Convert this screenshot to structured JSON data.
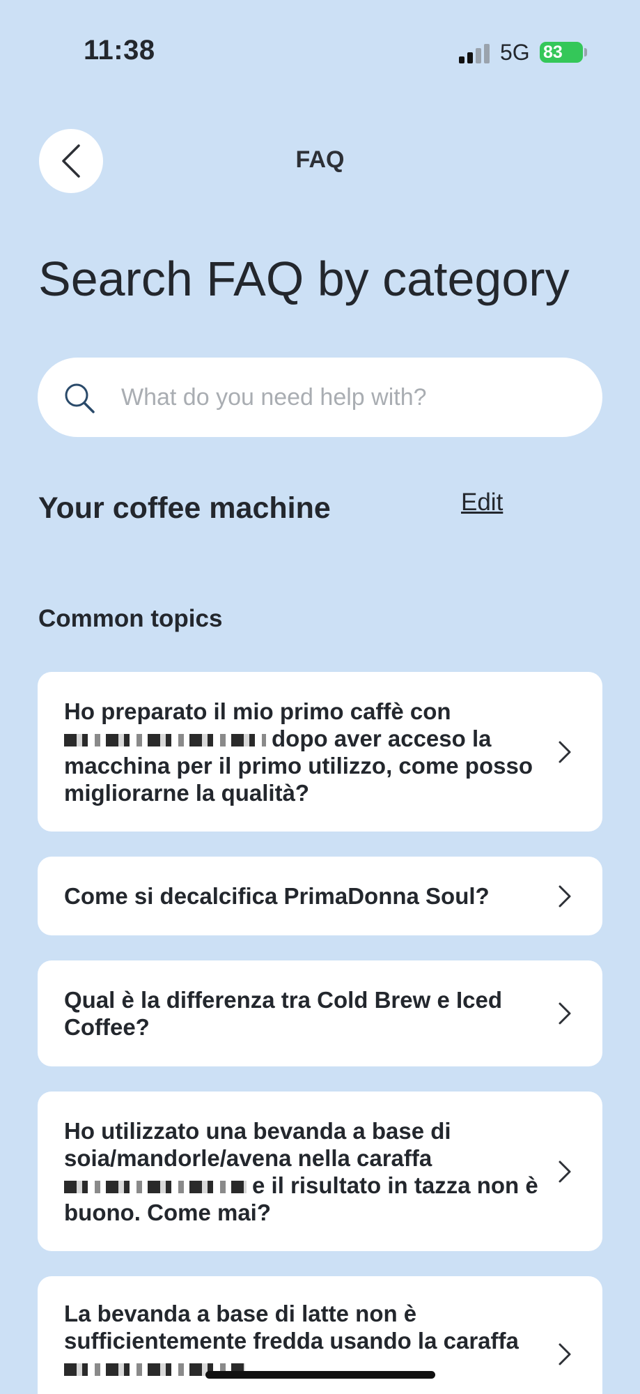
{
  "status_bar": {
    "time": "11:38",
    "network": "5G",
    "battery": "83"
  },
  "header": {
    "title": "FAQ"
  },
  "page_title": "Search FAQ by category",
  "search": {
    "placeholder": "What do you need help with?",
    "value": ""
  },
  "machine_section": {
    "title": "Your coffee machine",
    "edit_label": "Edit"
  },
  "common_topics": {
    "title": "Common topics",
    "items": [
      {
        "before": "Ho preparato il mio primo caffè con",
        "after": "dopo aver acceso la macchina per il primo utilizzo, come posso migliorarne la qualità?"
      },
      {
        "before": "Come si decalcifica PrimaDonna Soul?",
        "after": ""
      },
      {
        "before": "Qual è la differenza tra Cold Brew e Iced Coffee?",
        "after": ""
      },
      {
        "before": "Ho utilizzato una bevanda a base di soia/mandorle/avena nella caraffa",
        "after": "e il risultato in tazza non è buono. Come mai?"
      },
      {
        "before": "La bevanda a base di latte non è sufficientemente fredda usando la caraffa",
        "after": ""
      }
    ]
  },
  "colors": {
    "background": "#cce0f5",
    "card": "#ffffff",
    "text": "#23272d",
    "battery": "#34c759"
  }
}
